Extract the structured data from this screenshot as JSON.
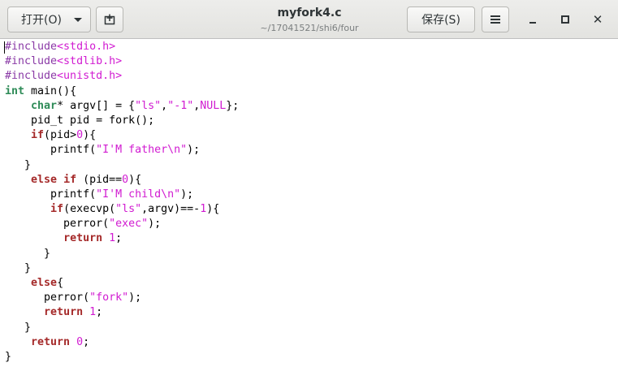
{
  "header": {
    "open_label": "打开(O)",
    "new_doc_icon": "new-document-icon",
    "title": "myfork4.c",
    "subtitle": "~/17041521/shi6/four",
    "save_label": "保存(S)",
    "menu_icon": "hamburger-menu-icon",
    "minimize_icon": "minimize-icon",
    "maximize_icon": "maximize-icon",
    "close_icon": "close-icon"
  },
  "editor": {
    "lines": [
      [
        {
          "t": "#include",
          "c": "pp"
        },
        {
          "t": "<stdio.h>",
          "c": "hd"
        }
      ],
      [
        {
          "t": "#include",
          "c": "pp"
        },
        {
          "t": "<stdlib.h>",
          "c": "hd"
        }
      ],
      [
        {
          "t": "#include",
          "c": "pp"
        },
        {
          "t": "<unistd.h>",
          "c": "hd"
        }
      ],
      [
        {
          "t": "int",
          "c": "ty"
        },
        {
          "t": " main(){"
        }
      ],
      [
        {
          "t": "    "
        },
        {
          "t": "char",
          "c": "ty"
        },
        {
          "t": "* argv[] = {"
        },
        {
          "t": "\"ls\"",
          "c": "st"
        },
        {
          "t": ","
        },
        {
          "t": "\"-1\"",
          "c": "st"
        },
        {
          "t": ","
        },
        {
          "t": "NULL",
          "c": "nm"
        },
        {
          "t": "};"
        }
      ],
      [
        {
          "t": "    pid_t pid = fork();"
        }
      ],
      [
        {
          "t": "    "
        },
        {
          "t": "if",
          "c": "kw"
        },
        {
          "t": "(pid>"
        },
        {
          "t": "0",
          "c": "nm"
        },
        {
          "t": "){"
        }
      ],
      [
        {
          "t": "       printf("
        },
        {
          "t": "\"I'M father\\n\"",
          "c": "st"
        },
        {
          "t": ");"
        }
      ],
      [
        {
          "t": "   }"
        }
      ],
      [
        {
          "t": "    "
        },
        {
          "t": "else",
          "c": "kw"
        },
        {
          "t": " "
        },
        {
          "t": "if",
          "c": "kw"
        },
        {
          "t": " (pid=="
        },
        {
          "t": "0",
          "c": "nm"
        },
        {
          "t": "){"
        }
      ],
      [
        {
          "t": "       printf("
        },
        {
          "t": "\"I'M child\\n\"",
          "c": "st"
        },
        {
          "t": ");"
        }
      ],
      [
        {
          "t": "       "
        },
        {
          "t": "if",
          "c": "kw"
        },
        {
          "t": "(execvp("
        },
        {
          "t": "\"ls\"",
          "c": "st"
        },
        {
          "t": ",argv)==-"
        },
        {
          "t": "1",
          "c": "nm"
        },
        {
          "t": "){"
        }
      ],
      [
        {
          "t": "         perror("
        },
        {
          "t": "\"exec\"",
          "c": "st"
        },
        {
          "t": ");"
        }
      ],
      [
        {
          "t": "         "
        },
        {
          "t": "return",
          "c": "kw"
        },
        {
          "t": " "
        },
        {
          "t": "1",
          "c": "nm"
        },
        {
          "t": ";"
        }
      ],
      [
        {
          "t": "      }"
        }
      ],
      [
        {
          "t": "   }"
        }
      ],
      [
        {
          "t": "    "
        },
        {
          "t": "else",
          "c": "kw"
        },
        {
          "t": "{"
        }
      ],
      [
        {
          "t": "      perror("
        },
        {
          "t": "\"fork\"",
          "c": "st"
        },
        {
          "t": ");"
        }
      ],
      [
        {
          "t": "      "
        },
        {
          "t": "return",
          "c": "kw"
        },
        {
          "t": " "
        },
        {
          "t": "1",
          "c": "nm"
        },
        {
          "t": ";"
        }
      ],
      [
        {
          "t": "   }"
        }
      ],
      [
        {
          "t": "    "
        },
        {
          "t": "return",
          "c": "kw"
        },
        {
          "t": " "
        },
        {
          "t": "0",
          "c": "nm"
        },
        {
          "t": ";"
        }
      ],
      [
        {
          "t": "}"
        }
      ]
    ]
  }
}
